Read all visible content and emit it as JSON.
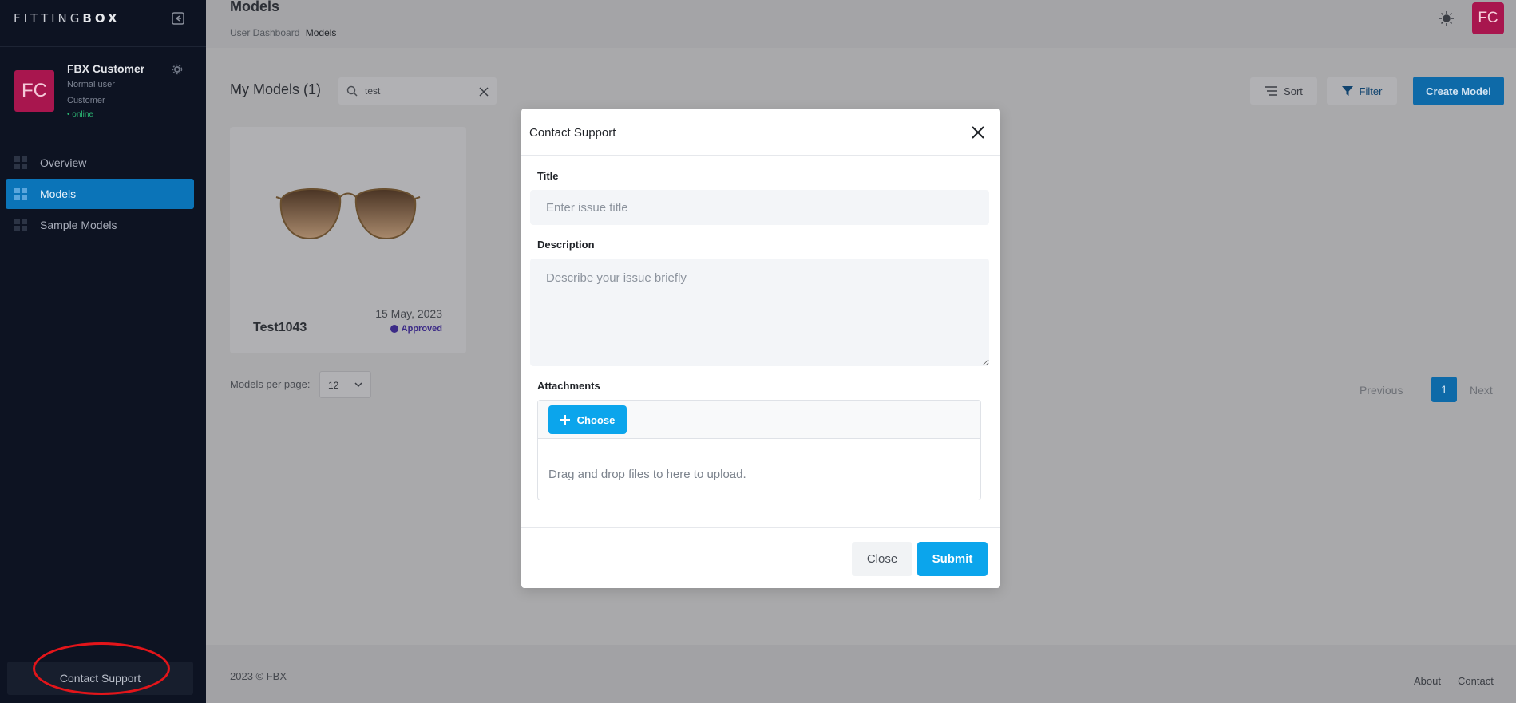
{
  "sidebar": {
    "logo_left": "FITTING",
    "logo_right": "BOX",
    "profile": {
      "initials": "FC",
      "name": "FBX Customer",
      "role": "Normal user",
      "type": "Customer",
      "status": "• online"
    },
    "nav": [
      {
        "label": "Overview",
        "icon": "grid-icon"
      },
      {
        "label": "Models",
        "icon": "grid-icon",
        "active": true
      },
      {
        "label": "Sample Models",
        "icon": "grid-icon"
      }
    ],
    "contact_support": "Contact Support"
  },
  "header": {
    "title": "Models",
    "breadcrumb": [
      "User Dashboard",
      "Models"
    ],
    "avatar_initials": "FC"
  },
  "content": {
    "heading": "My Models (1)",
    "search": {
      "value": "test"
    },
    "sort_label": "Sort",
    "filter_label": "Filter",
    "create_label": "Create Model",
    "models": [
      {
        "name": "Test1043",
        "date": "15 May, 2023",
        "status": "Approved"
      }
    ],
    "per_page_label": "Models per page:",
    "per_page_value": "12",
    "pagination": {
      "previous": "Previous",
      "current": "1",
      "next": "Next"
    }
  },
  "footer": {
    "copyright": "2023 ©  FBX",
    "about": "About",
    "contact": "Contact"
  },
  "modal": {
    "title": "Contact Support",
    "title_label": "Title",
    "title_placeholder": "Enter issue title",
    "description_label": "Description",
    "description_placeholder": "Describe your issue briefly",
    "attachments_label": "Attachments",
    "choose_label": "Choose",
    "drop_text": "Drag and drop files to here to upload.",
    "close_label": "Close",
    "submit_label": "Submit"
  },
  "colors": {
    "primary": "#0ba5ec",
    "sidebar_bg": "#0d1322",
    "avatar": "#a8164e",
    "annotation_ring": "#e3151a"
  }
}
